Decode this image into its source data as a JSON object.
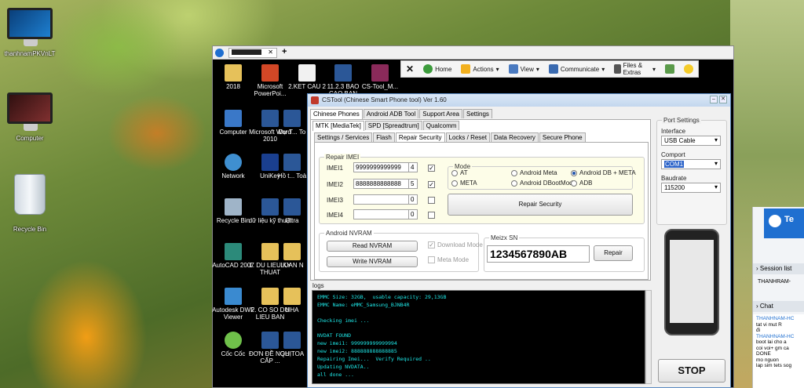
{
  "desktop": {
    "icons": [
      {
        "label": "thanhnamPKVnLT"
      },
      {
        "label": "Computer"
      },
      {
        "label": "Recycle Bin"
      }
    ]
  },
  "remote_desktop": {
    "icons": [
      {
        "label": "2018"
      },
      {
        "label": "Microsoft PowerPoi..."
      },
      {
        "label": "2.KET CAU 2"
      },
      {
        "label": "11.2.3 BAO CAO BAN"
      },
      {
        "label": "CS-Tool_M..."
      },
      {
        "label": "Computer"
      },
      {
        "label": "Microsoft Word 2010"
      },
      {
        "label": "Dự T... To"
      },
      {
        "label": "Network"
      },
      {
        "label": "UniKey"
      },
      {
        "label": "Hồ t... Toà"
      },
      {
        "label": "Recycle Bin"
      },
      {
        "label": "dữ liệu kỹ thuật"
      },
      {
        "label": "Ultra"
      },
      {
        "label": "AutoCAD 2007"
      },
      {
        "label": "1. DU LIEU KY THUAT"
      },
      {
        "label": "LUAN N"
      },
      {
        "label": "Autodesk DWF Viewer"
      },
      {
        "label": "2. CO SO DU LIEU BAN"
      },
      {
        "label": "NHA"
      },
      {
        "label": "Cốc Cốc"
      },
      {
        "label": "ĐƠN ĐỀ NGHỊ CẤP ..."
      },
      {
        "label": "QU TOA"
      }
    ]
  },
  "toolbar": {
    "home": "Home",
    "actions": "Actions",
    "view": "View",
    "communicate": "Communicate",
    "files": "Files & Extras"
  },
  "cstool": {
    "title": "CSTool (Chinese Smart Phone tool)  Ver 1.60",
    "main_tabs": [
      "Chinese Phones",
      "Android ADB Tool",
      "Support Area",
      "Settings"
    ],
    "chip_tabs": [
      "MTK [MediaTek]",
      "SPD [Spreadtrum]",
      "Qualcomm"
    ],
    "func_tabs": [
      "Settings / Services",
      "Flash",
      "Repair Security",
      "Locks / Reset",
      "Data Recovery",
      "Secure Phone"
    ],
    "repair_imei": {
      "title": "Repair IMEI",
      "rows": [
        {
          "label": "IMEI1",
          "value": "9999999999999",
          "count": "4",
          "checked": true
        },
        {
          "label": "IMEI2",
          "value": "8888888888888",
          "count": "5",
          "checked": true
        },
        {
          "label": "IMEI3",
          "value": "",
          "count": "0",
          "checked": false
        },
        {
          "label": "IMEI4",
          "value": "",
          "count": "0",
          "checked": false
        }
      ],
      "mode_title": "Mode",
      "modes": [
        "AT",
        "Android Meta",
        "Android DB + META",
        "META",
        "Android DBootMode",
        "ADB"
      ],
      "selected_mode": "Android DB + META",
      "repair_button": "Repair Security"
    },
    "nvram": {
      "title": "Android NVRAM",
      "read": "Read NVRAM",
      "write": "Write NVRAM",
      "download_mode": "Download Mode",
      "meta_mode": "Meta Mode"
    },
    "meizu": {
      "title": "Meizx SN",
      "value": "1234567890AB",
      "button": "Repair"
    },
    "logs_title": "logs",
    "logs": [
      "EMMC Size: 32GB,  usable capacity: 29,13GB",
      "EMMC Name: eMMC_Samsung_BJNB4R",
      "",
      "Checking imei ...",
      "",
      "NVDAT FOUND",
      "new imei1: 999999999999994",
      "new imei2: 888888888888885",
      "Repairing Imei...  Verify Required ..",
      "Updating NVDATA..",
      "all done ..."
    ],
    "port_settings": {
      "title": "Port Settings",
      "interface_label": "Interface",
      "interface": "USB Cable",
      "comport_label": "Comport",
      "comport": "COM1",
      "baudrate_label": "Baudrate",
      "baudrate": "115200"
    },
    "stop": "STOP"
  },
  "teamviewer_panel": {
    "title": "Te",
    "session_list": "Session list",
    "session_user": "THANHRAM-",
    "chat": "Chat",
    "chat_lines": [
      "THANHNAM-HC",
      "tat vi mut R",
      "đi",
      "THANHNAM-HC",
      "boot lai cho a",
      "coi voi+ gm ca",
      "DONE",
      "mo nguon",
      "lap sim tets sog"
    ]
  }
}
